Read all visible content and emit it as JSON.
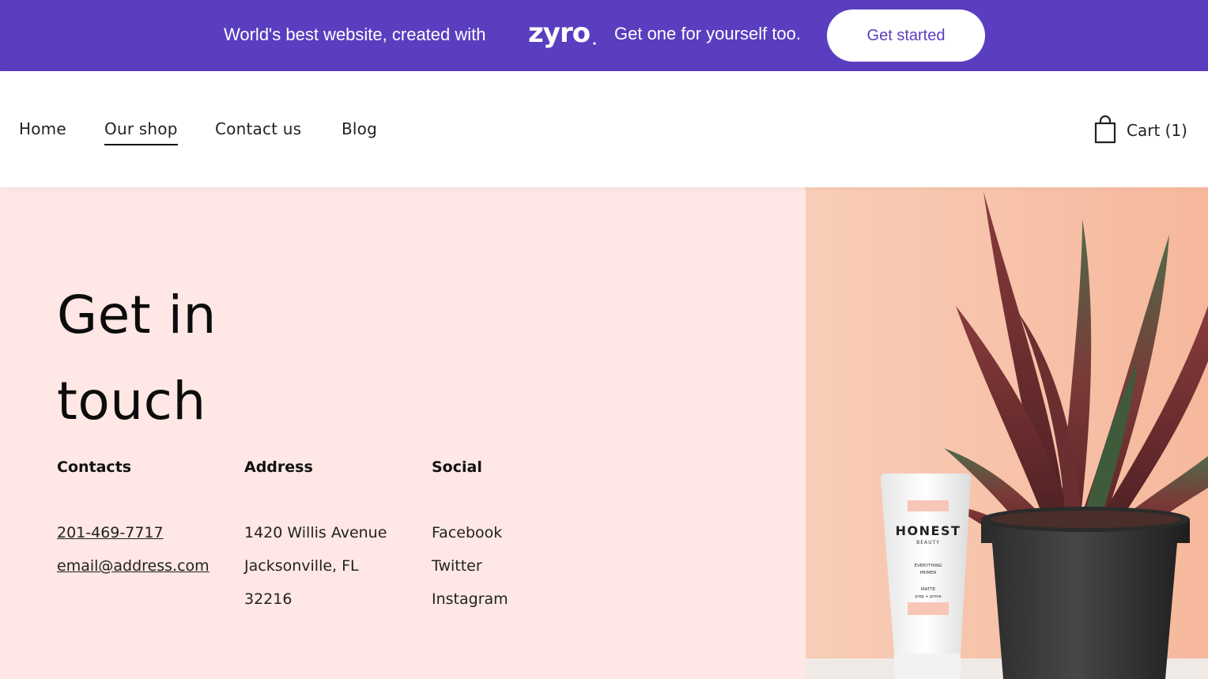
{
  "promo": {
    "text_before": "World's best website, created with",
    "logo_text": "zyro",
    "text_after": "Get one for yourself too.",
    "button_label": "Get started",
    "accent": "#5a3ebf"
  },
  "nav": {
    "items": [
      {
        "label": "Home"
      },
      {
        "label": "Our shop",
        "active": true
      },
      {
        "label": "Contact us"
      },
      {
        "label": "Blog"
      }
    ],
    "cart_label": "Cart (1)",
    "cart_icon": "shopping-bag-icon"
  },
  "main": {
    "title_line1": "Get in",
    "title_line2": "touch",
    "background": "#fee7e4",
    "contacts": {
      "heading": "Contacts",
      "phone": "201-469-7717",
      "email": "email@address.com"
    },
    "address": {
      "heading": "Address",
      "line1": "1420 Willis Avenue",
      "line2": "Jacksonville, FL",
      "line3": "32216"
    },
    "social": {
      "heading": "Social",
      "items": [
        "Facebook",
        "Twitter",
        "Instagram"
      ]
    }
  },
  "image": {
    "product_brand": "HONEST",
    "product_sub": "BEAUTY",
    "product_line1": "EVERYTHING",
    "product_line2": "PRIMER",
    "product_line3": "MATTE",
    "product_line4": "prep + prime"
  }
}
